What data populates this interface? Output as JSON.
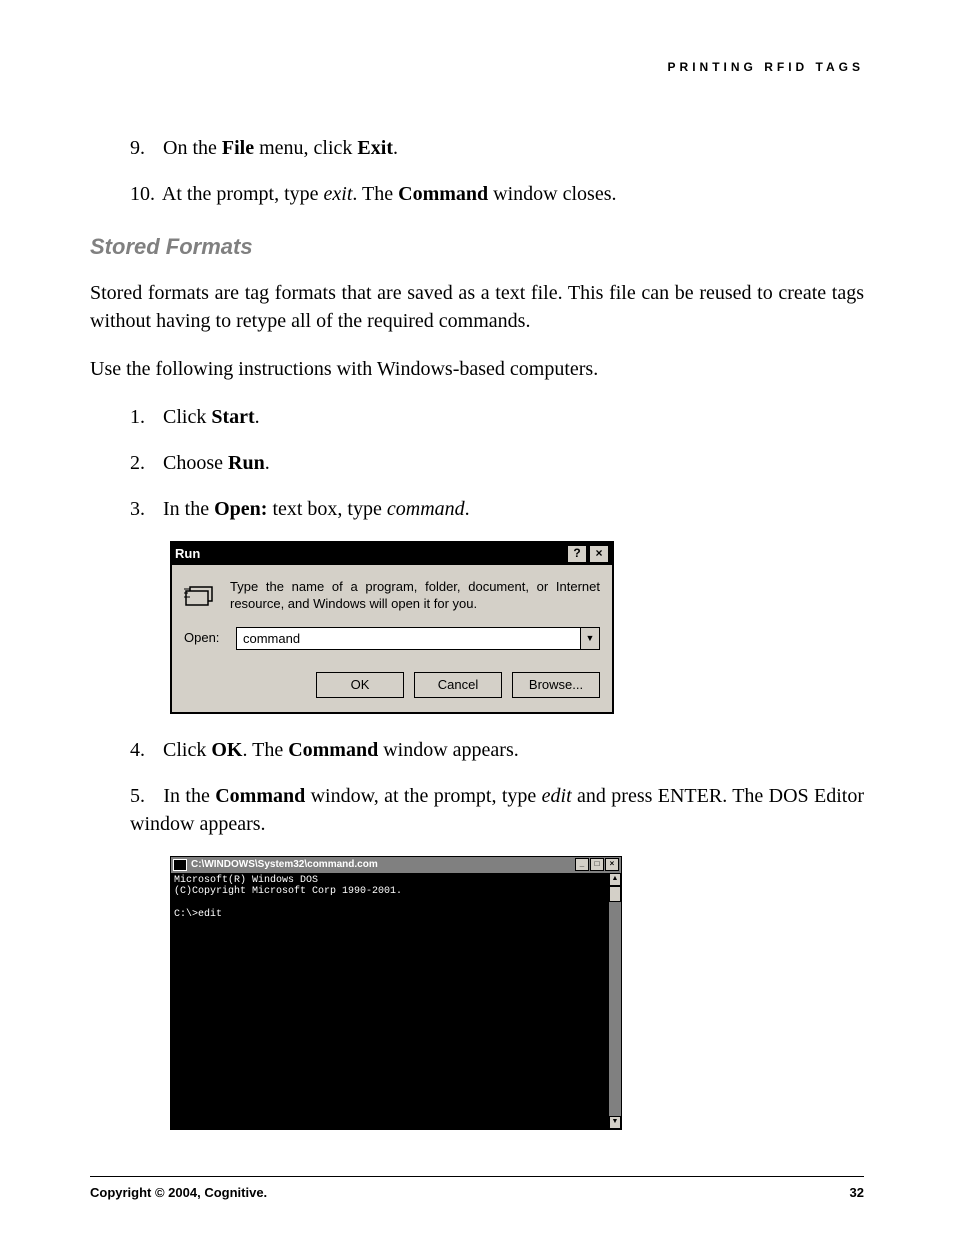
{
  "header": {
    "section_title": "PRINTING RFID TAGS"
  },
  "steps_top": {
    "s9_num": "9.",
    "s9_a": "On the ",
    "s9_b": "File",
    "s9_c": " menu, click ",
    "s9_d": "Exit",
    "s9_e": ".",
    "s10_num": "10.",
    "s10_a": "At the prompt, type ",
    "s10_b": "exit",
    "s10_c": ". The ",
    "s10_d": "Command",
    "s10_e": " window closes."
  },
  "heading": "Stored Formats",
  "para1": "Stored formats are tag formats that are saved as a text file. This file can be reused to create tags without having to retype all of the required commands.",
  "para2": "Use the following instructions with Windows-based computers.",
  "steps_mid": {
    "s1_num": "1.",
    "s1_a": "Click ",
    "s1_b": "Start",
    "s1_c": ".",
    "s2_num": "2.",
    "s2_a": "Choose ",
    "s2_b": "Run",
    "s2_c": ".",
    "s3_num": "3.",
    "s3_a": "In the ",
    "s3_b": "Open:",
    "s3_c": " text box, type ",
    "s3_d": "command",
    "s3_e": "."
  },
  "run_dialog": {
    "title": "Run",
    "desc": "Type the name of a program, folder, document, or Internet resource, and Windows will open it for you.",
    "open_label": "Open:",
    "open_value": "command",
    "btn_ok": "OK",
    "btn_cancel": "Cancel",
    "btn_browse": "Browse...",
    "help_glyph": "?",
    "close_glyph": "×",
    "dd_glyph": "▼"
  },
  "steps_after": {
    "s4_num": "4.",
    "s4_a": "Click ",
    "s4_b": "OK",
    "s4_c": ". The ",
    "s4_d": "Command",
    "s4_e": " window appears.",
    "s5_num": "5.",
    "s5_a": "In the ",
    "s5_b": "Command",
    "s5_c": " window, at the prompt, type ",
    "s5_d": "edit",
    "s5_e": " and press ENTER. The DOS Editor window appears."
  },
  "cmd_window": {
    "title": "C:\\WINDOWS\\System32\\command.com",
    "line1": "Microsoft(R) Windows DOS",
    "line2": "(C)Copyright Microsoft Corp 1990-2001.",
    "blank": "",
    "line3": "C:\\>edit",
    "min_glyph": "_",
    "max_glyph": "□",
    "close_glyph": "×",
    "up_glyph": "▲",
    "down_glyph": "▼"
  },
  "footer": {
    "copyright": "Copyright © 2004, Cognitive.",
    "page_num": "32"
  }
}
